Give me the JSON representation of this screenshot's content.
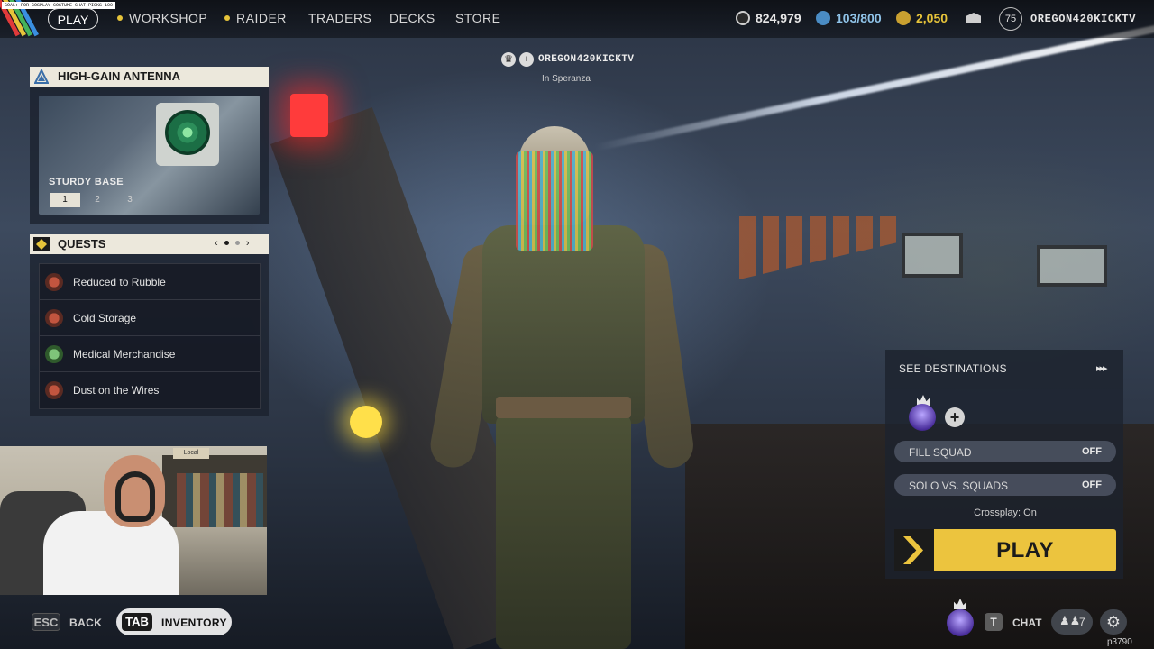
{
  "ticker": "GOAL: FOR COSPLAY COSTUME CHAT PICKS  100",
  "nav": {
    "play": "PLAY",
    "workshop": "WORKSHOP",
    "raider": "RAIDER",
    "traders": "TRADERS",
    "decks": "DECKS",
    "store": "STORE"
  },
  "currencies": {
    "coins": "824,979",
    "cred": "103/800",
    "raider_tokens": "2,050"
  },
  "profile": {
    "level": "75",
    "username": "OREGON420KICKTV"
  },
  "player_tag": {
    "name": "OREGON420KICKTV",
    "location": "In Speranza"
  },
  "antenna": {
    "title": "HIGH-GAIN ANTENNA",
    "subtitle": "STURDY BASE",
    "tiers": [
      "1",
      "2",
      "3"
    ]
  },
  "quests": {
    "title": "QUESTS",
    "pager_prev": "‹",
    "pager_next": "›",
    "items": [
      {
        "label": "Reduced to Rubble",
        "icon_color": "#8a3a2f"
      },
      {
        "label": "Cold Storage",
        "icon_color": "#8a3a2f"
      },
      {
        "label": "Medical Merchandise",
        "icon_color": "#4d8a4a"
      },
      {
        "label": "Dust on the Wires",
        "icon_color": "#8a3a2f"
      }
    ]
  },
  "webcam": {
    "sign": "Local"
  },
  "bottom_bar": {
    "esc_key": "ESC",
    "back": "BACK",
    "tab_key": "TAB",
    "inventory": "INVENTORY",
    "chat_key": "T",
    "chat": "CHAT",
    "friends_count": "7",
    "build": "p3790"
  },
  "play_panel": {
    "see_destinations": "SEE DESTINATIONS",
    "fill_squad_label": "FILL SQUAD",
    "fill_squad_value": "OFF",
    "solo_vs_squads_label": "SOLO VS. SQUADS",
    "solo_vs_squads_value": "OFF",
    "crossplay": "Crossplay: On",
    "play": "PLAY"
  },
  "colors": {
    "accent_yellow": "#ecc43e",
    "header_cream": "#ece8dc"
  }
}
